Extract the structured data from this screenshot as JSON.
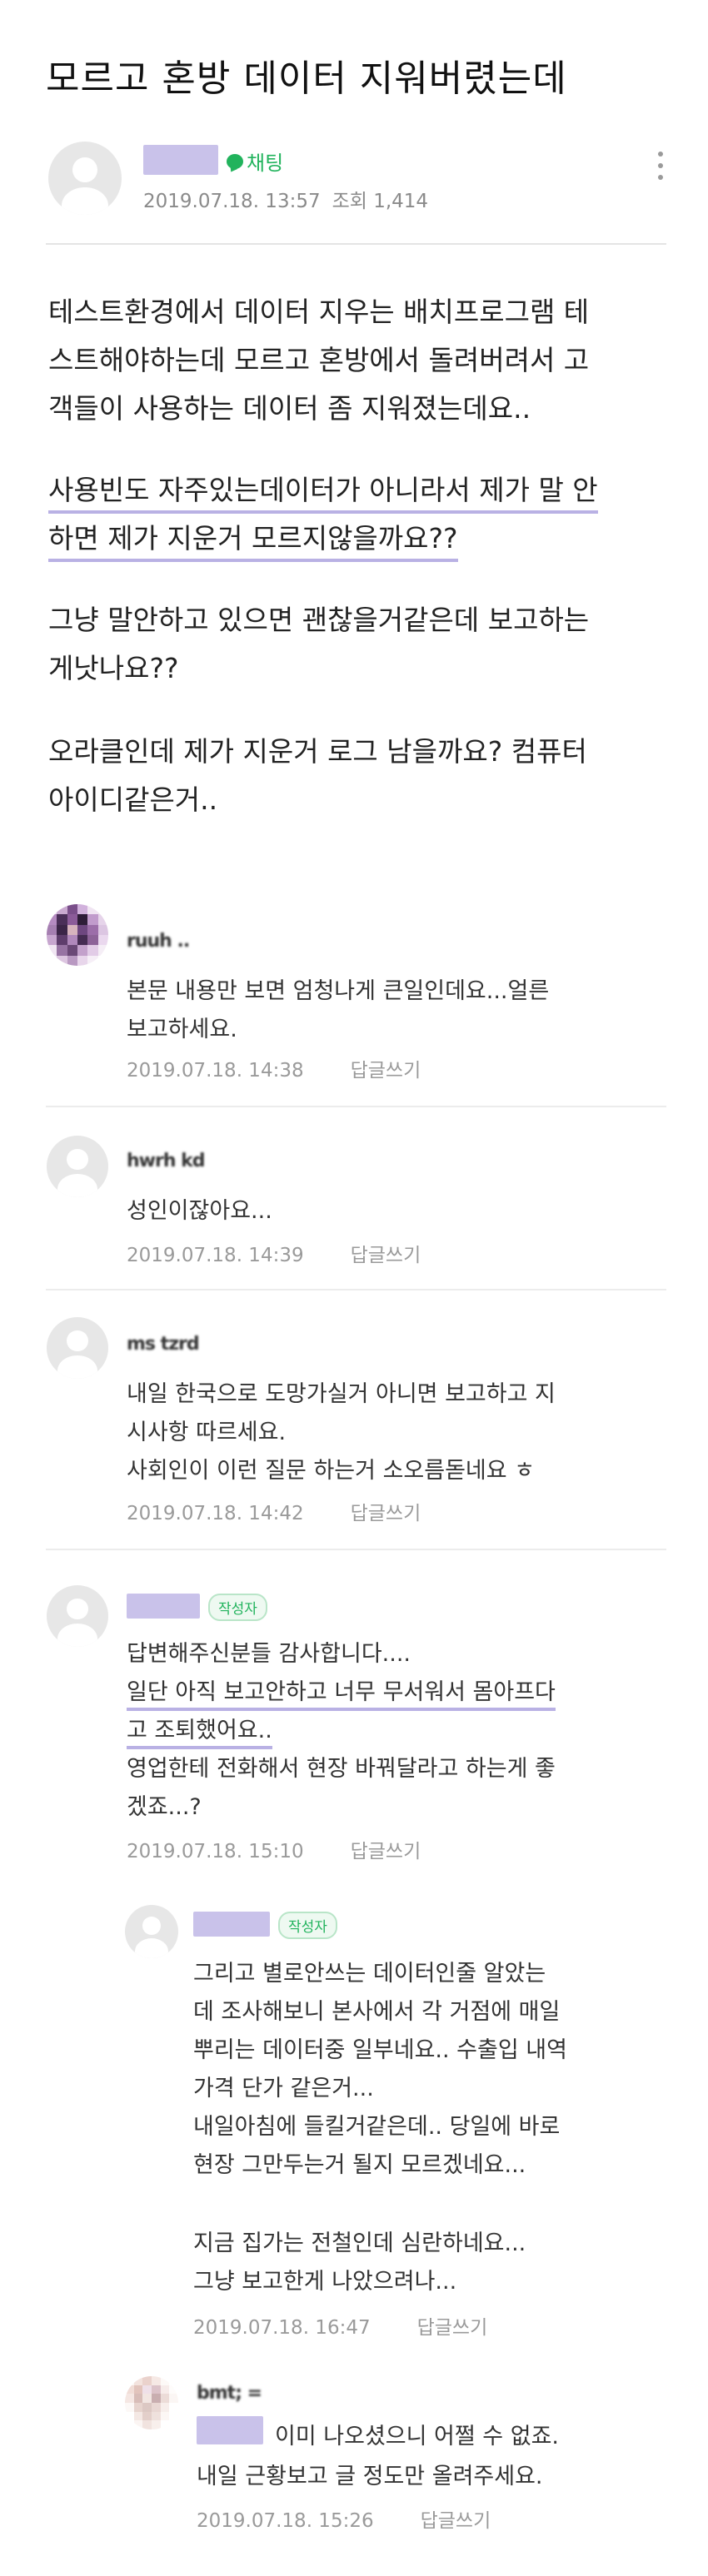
{
  "post": {
    "title": "모르고 혼방 데이터 지워버렸는데",
    "chat_label": "채팅",
    "date": "2019.07.18. 13:57",
    "views": "조회 1,414",
    "body_lines": [
      "테스트환경에서 데이터 지우는 배치프로그램 테",
      "스트해야하는데 모르고 혼방에서 돌려버려서 고",
      "객들이 사용하는 데이터 좀 지워졌는데요..",
      "사용빈도 자주있는데이터가 아니라서 제가 말 안",
      "하면 제가 지운거 모르지않을까요??",
      "그냥 말안하고 있으면 괜찮을거같은데 보고하는",
      "게낫나요??",
      "오라클인데 제가 지운거 로그 남을까요? 컴퓨터",
      "아이디같은거.."
    ]
  },
  "comments": [
    {
      "name": "ruuh ..",
      "lines": [
        "본문 내용만 보면 엄청나게 큰일인데요...얼른",
        "보고하세요."
      ],
      "date": "2019.07.18. 14:38",
      "reply": "답글쓰기"
    },
    {
      "name": "hwrh kd",
      "lines": [
        "성인이잖아요..."
      ],
      "date": "2019.07.18. 14:39",
      "reply": "답글쓰기"
    },
    {
      "name": "ms tzrd",
      "lines": [
        "내일 한국으로 도망가실거 아니면 보고하고 지",
        "시사항 따르세요.",
        "사회인이 이런 질문 하는거 소오름돋네요 ㅎ"
      ],
      "date": "2019.07.18. 14:42",
      "reply": "답글쓰기"
    },
    {
      "badge": "작성자",
      "lines": [
        "답변해주신분들 감사합니다....",
        "일단 아직 보고안하고 너무 무서워서 몸아프다",
        "고 조퇴했어요..",
        "영업한테 전화해서 현장 바꿔달라고 하는게 좋",
        "겠죠...?"
      ],
      "date": "2019.07.18. 15:10",
      "reply": "답글쓰기"
    }
  ],
  "replies": [
    {
      "badge": "작성자",
      "lines": [
        "그리고 별로안쓰는 데이터인줄 알았는",
        "데 조사해보니 본사에서 각 거점에 매일",
        "뿌리는 데이터중 일부네요.. 수출입 내역",
        "가격 단가 같은거...",
        "내일아침에 들킬거같은데.. 당일에 바로",
        "현장 그만두는거 될지 모르겠네요...",
        "",
        "지금 집가는 전철인데 심란하네요...",
        "그냥 보고한게 나았으려나..."
      ],
      "date": "2019.07.18. 16:47",
      "reply": "답글쓰기"
    },
    {
      "name": "bmt; =",
      "lines": [
        "이미 나오셨으니 어쩔 수 없죠.",
        "내일 근황보고 글 정도만 올려주세요."
      ],
      "date": "2019.07.18. 15:26",
      "reply": "답글쓰기"
    }
  ],
  "colors": {
    "accent": "#21b35c",
    "highlight": "#b9b1e4",
    "nick_blur": "#c9c2ea"
  }
}
